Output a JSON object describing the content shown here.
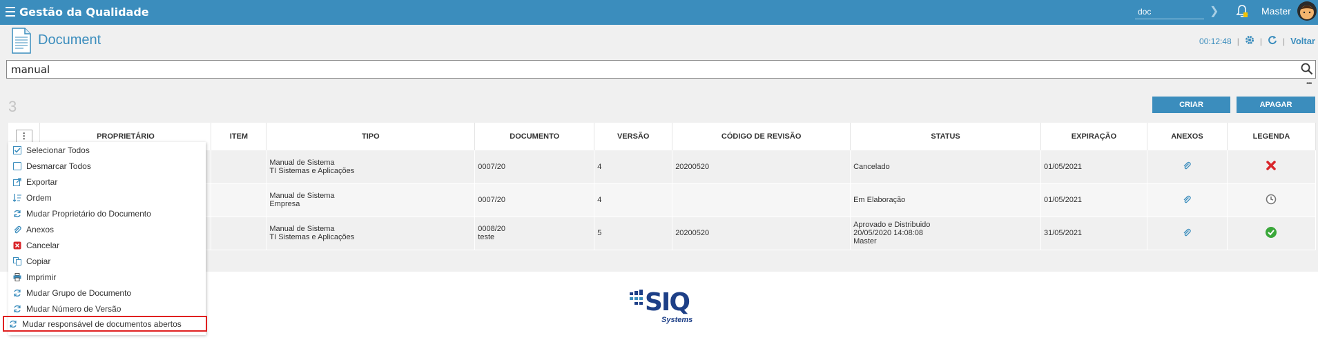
{
  "app": {
    "title": "Gestão da Qualidade"
  },
  "topbar": {
    "search_value": "doc",
    "user": "Master"
  },
  "header": {
    "title": "Document",
    "timer": "00:12:48",
    "back_label": "Voltar",
    "separator": "|"
  },
  "filter": {
    "value": "manual",
    "more": "•••"
  },
  "results": {
    "count": "3"
  },
  "buttons": {
    "create": "CRIAR",
    "delete": "APAGAR"
  },
  "table": {
    "columns": [
      "PROPRIETÁRIO",
      "ITEM",
      "TIPO",
      "DOCUMENTO",
      "VERSÃO",
      "CÓDIGO DE REVISÃO",
      "STATUS",
      "EXPIRAÇÃO",
      "ANEXOS",
      "LEGENDA"
    ],
    "rows": [
      {
        "tipo": [
          "Manual de Sistema",
          "TI Sistemas e Aplicações"
        ],
        "documento": [
          "0007/20",
          ""
        ],
        "versao": "4",
        "codigo": "20200520",
        "status": [
          "Cancelado",
          "",
          ""
        ],
        "expiracao": "01/05/2021",
        "legenda": "cancel-icon"
      },
      {
        "tipo": [
          "Manual de Sistema",
          "Empresa"
        ],
        "documento": [
          "0007/20",
          ""
        ],
        "versao": "4",
        "codigo": "",
        "status": [
          "Em Elaboração",
          "",
          ""
        ],
        "expiracao": "01/05/2021",
        "legenda": "clock-icon"
      },
      {
        "tipo": [
          "Manual de Sistema",
          "TI Sistemas e Aplicações"
        ],
        "documento": [
          "0008/20",
          "teste"
        ],
        "versao": "5",
        "codigo": "20200520",
        "status": [
          "Aprovado e Distribuido",
          "20/05/2020 14:08:08",
          "Master"
        ],
        "expiracao": "31/05/2021",
        "legenda": "check-icon"
      }
    ]
  },
  "menu": {
    "items": [
      {
        "label": "Selecionar Todos",
        "icon": "checkbox-checked-icon"
      },
      {
        "label": "Desmarcar Todos",
        "icon": "checkbox-empty-icon"
      },
      {
        "label": "Exportar",
        "icon": "export-icon"
      },
      {
        "label": "Ordem",
        "icon": "sort-icon"
      },
      {
        "label": "Mudar Proprietário do Documento",
        "icon": "refresh-icon"
      },
      {
        "label": "Anexos",
        "icon": "paperclip-icon"
      },
      {
        "label": "Cancelar",
        "icon": "cancel-icon"
      },
      {
        "label": "Copiar",
        "icon": "copy-icon"
      },
      {
        "label": "Imprimir",
        "icon": "printer-icon"
      },
      {
        "label": "Mudar Grupo de Documento",
        "icon": "refresh-icon"
      },
      {
        "label": "Mudar Número de Versão",
        "icon": "refresh-icon"
      },
      {
        "label": "Mudar responsável de documentos abertos",
        "icon": "refresh-icon"
      }
    ]
  },
  "footer": {
    "logo_text": "SIQ",
    "logo_sub": "Systems"
  },
  "colors": {
    "primary": "#3b8dbd",
    "cancel": "#d9252a",
    "ok": "#3aa73a",
    "highlight": "#e02020"
  }
}
